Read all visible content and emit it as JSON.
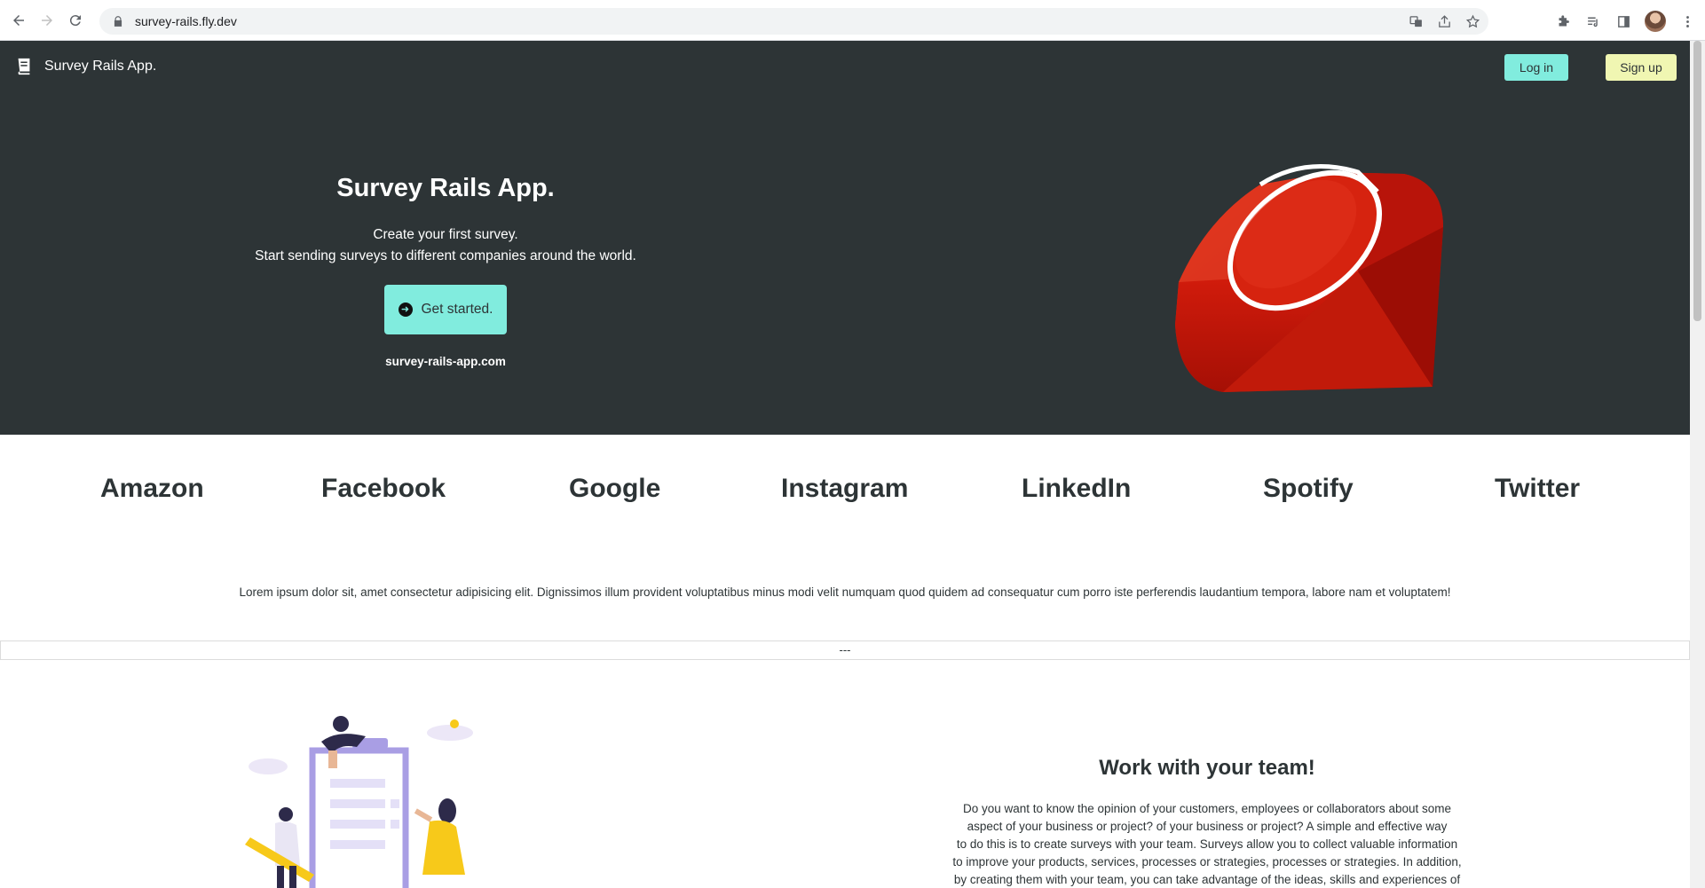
{
  "browser": {
    "url": "survey-rails.fly.dev"
  },
  "navbar": {
    "brand": "Survey Rails App.",
    "login_label": "Log in",
    "signup_label": "Sign up"
  },
  "hero": {
    "title": "Survey Rails App.",
    "subtitle_line1": "Create your first survey.",
    "subtitle_line2": "Start sending surveys to different companies around the world.",
    "cta_label": "Get started.",
    "site": "survey-rails-app.com"
  },
  "companies": [
    "Amazon",
    "Facebook",
    "Google",
    "Instagram",
    "LinkedIn",
    "Spotify",
    "Twitter"
  ],
  "lorem": "Lorem ipsum dolor sit, amet consectetur adipisicing elit. Dignissimos illum provident voluptatibus minus modi velit numquam quod quidem ad consequatur cum porro iste perferendis laudantium tempora, labore nam et voluptatem!",
  "divider": "---",
  "team": {
    "title": "Work with your team!",
    "lines": [
      "Do you want to know the opinion of your customers, employees or collaborators about some",
      "aspect of your business or project? of your business or project? A simple and effective way",
      "to do this is to create surveys with your team. Surveys allow you to collect valuable information",
      "to improve your products, services, processes or strategies, processes or strategies. In addition,",
      "by creating them with your team, you can take advantage of the ideas, skills and experiences of"
    ]
  },
  "colors": {
    "hero_bg": "#2d3436",
    "login_bg": "#81ecde",
    "signup_bg": "#f0f6b2"
  }
}
